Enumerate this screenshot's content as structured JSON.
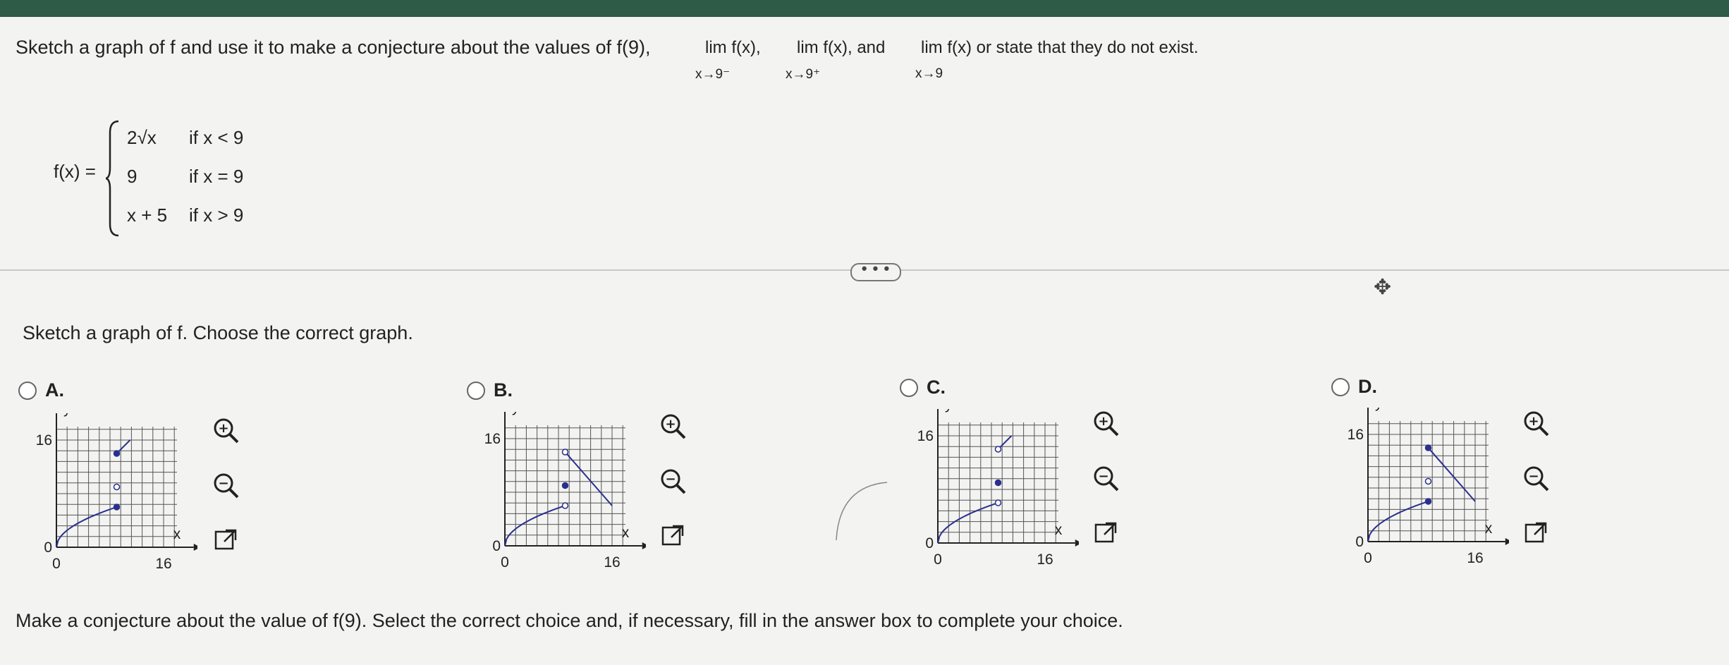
{
  "question": {
    "text_before": "Sketch a graph of f and use it to make a conjecture about the values of f(9),",
    "lim1": "lim  f(x),",
    "lim1_sub": "x→9⁻",
    "lim2": "lim  f(x), and",
    "lim2_sub": "x→9⁺",
    "lim3": "lim  f(x) or state that they do not exist.",
    "lim3_sub": "x→9"
  },
  "function": {
    "label": "f(x) =",
    "cases": [
      {
        "expr": "2√x",
        "cond": "if x < 9"
      },
      {
        "expr": "9",
        "cond": "if x = 9"
      },
      {
        "expr": "x + 5",
        "cond": "if x > 9"
      }
    ]
  },
  "more_button": "• • •",
  "prompt": "Sketch a graph of f. Choose the correct graph.",
  "options": [
    {
      "letter": "A.",
      "y_tick": "16",
      "x_tick": "16",
      "origin_y": "0",
      "origin_x": "0",
      "y_label": "y",
      "x_label": "x"
    },
    {
      "letter": "B.",
      "y_tick": "16",
      "x_tick": "16",
      "origin_y": "0",
      "origin_x": "0",
      "y_label": "y",
      "x_label": "x"
    },
    {
      "letter": "C.",
      "y_tick": "16",
      "x_tick": "16",
      "origin_y": "0",
      "origin_x": "0",
      "y_label": "y",
      "x_label": "x"
    },
    {
      "letter": "D.",
      "y_tick": "16",
      "x_tick": "16",
      "origin_y": "0",
      "origin_x": "0",
      "y_label": "y",
      "x_label": "x"
    }
  ],
  "icons": {
    "zoom_in": "zoom-in-icon",
    "zoom_out": "zoom-out-icon",
    "popout": "external-link-icon",
    "move": "move-icon"
  },
  "bottom_prompt": "Make a conjecture about the value of f(9). Select the correct choice and, if necessary, fill in the answer box to complete your choice.",
  "colors": {
    "curve": "#2a2f8f",
    "topbar": "#2e5a48"
  }
}
